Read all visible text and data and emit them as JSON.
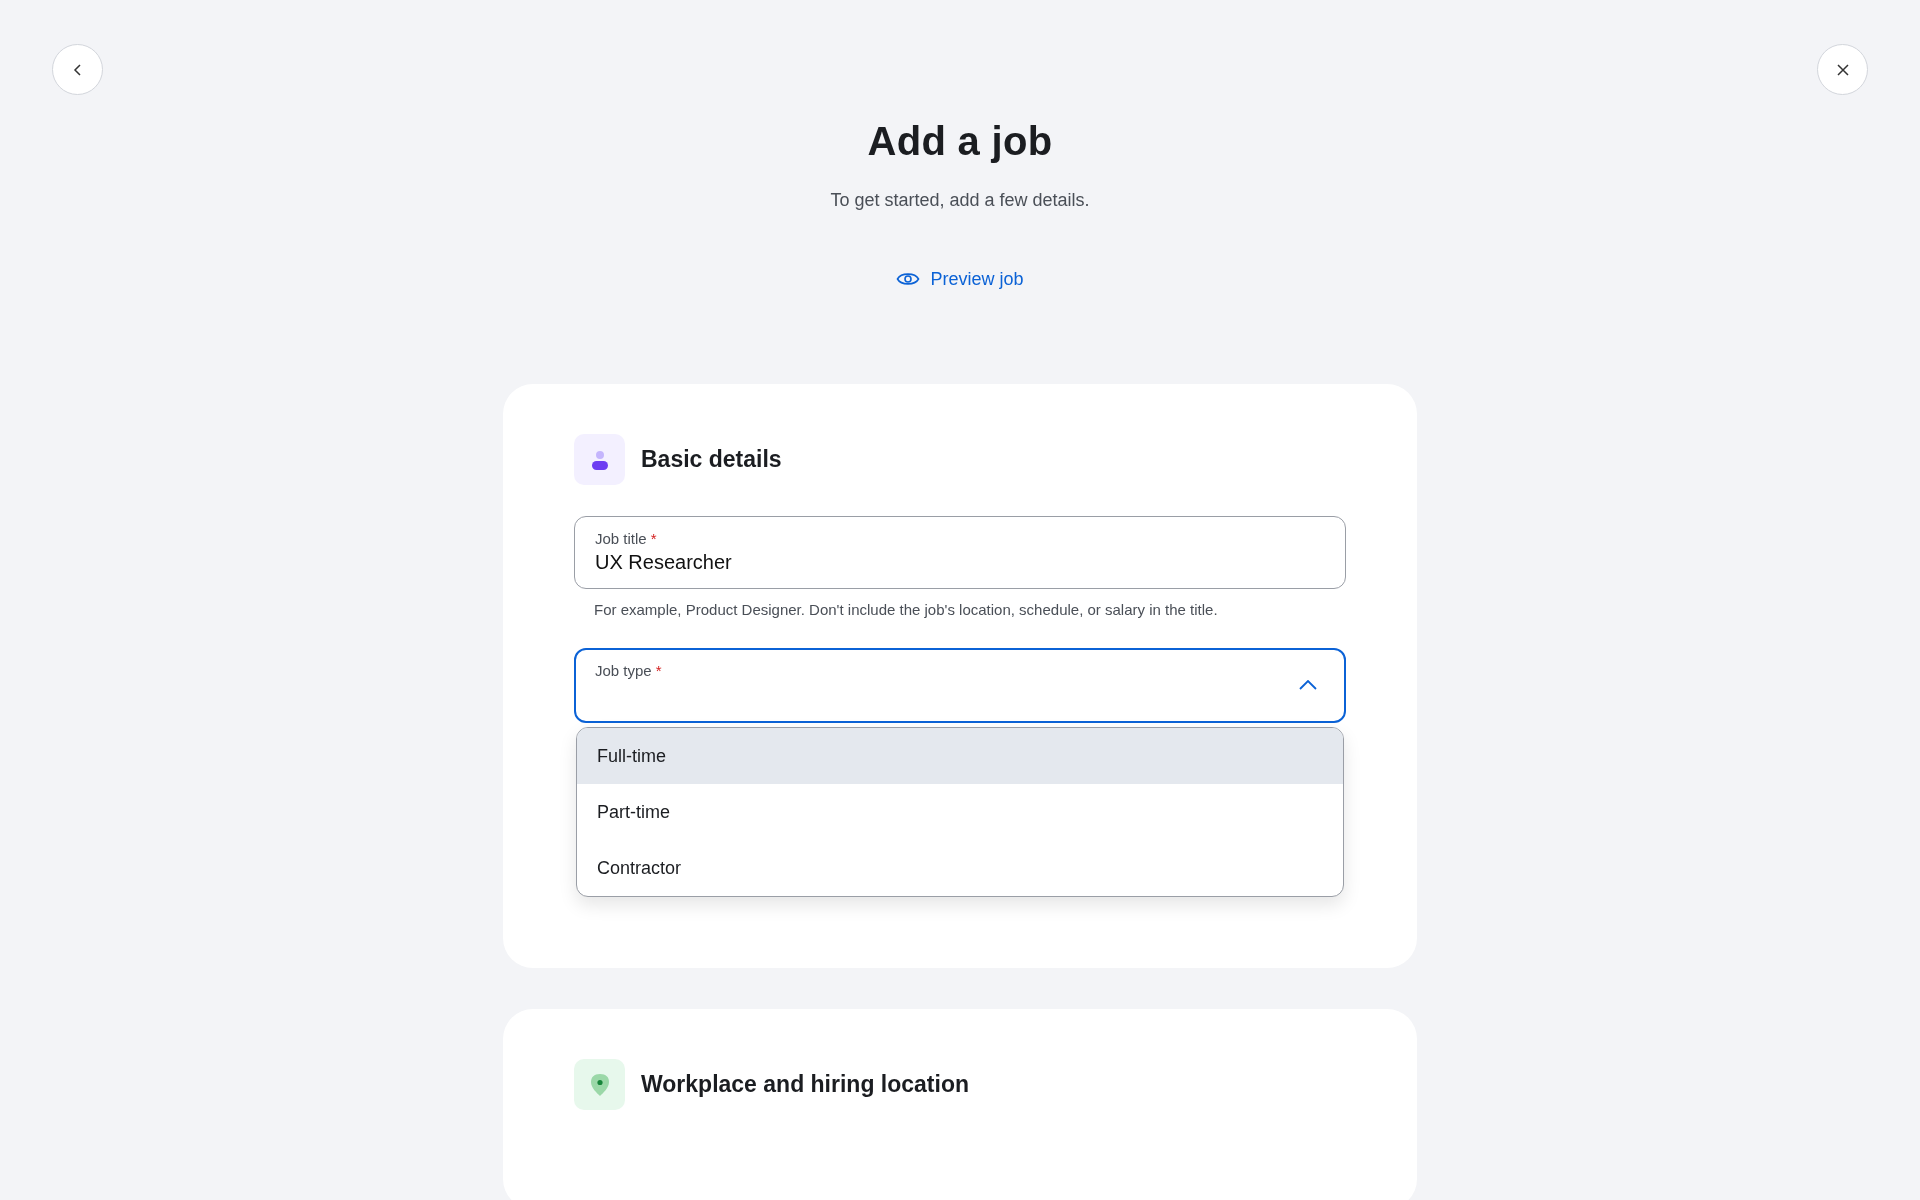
{
  "header": {
    "title": "Add a job",
    "subtitle": "To get started, add a few details.",
    "preview_link": "Preview job"
  },
  "sections": [
    {
      "kind": "person",
      "title": "Basic details",
      "fields": [
        {
          "kind": "text",
          "label": "Job title",
          "required_mark": "*",
          "value": "UX Researcher",
          "helper": "For example, Product Designer. Don't include the job's location, schedule, or salary in the title."
        },
        {
          "kind": "select",
          "label": "Job type",
          "required_mark": "*",
          "expanded": true,
          "options": [
            {
              "label": "Full-time",
              "selected": true
            },
            {
              "label": "Part-time",
              "selected": false
            },
            {
              "label": "Contractor",
              "selected": false
            }
          ]
        }
      ]
    },
    {
      "kind": "location",
      "title": "Workplace and hiring location"
    }
  ]
}
